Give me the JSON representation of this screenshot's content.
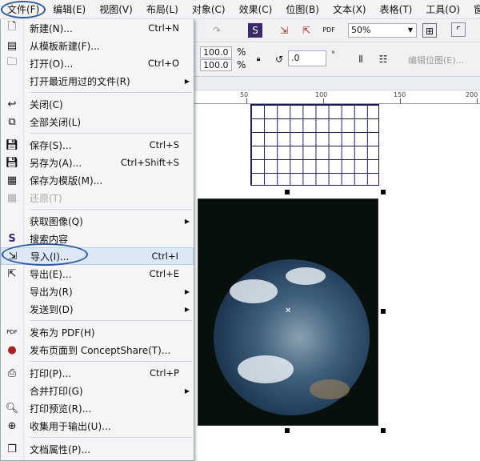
{
  "menubar": [
    "文件(F)",
    "编辑(E)",
    "视图(V)",
    "布局(L)",
    "对象(C)",
    "效果(C)",
    "位图(B)",
    "文本(X)",
    "表格(T)",
    "工具(O)",
    "窗口"
  ],
  "toolbar": {
    "zoom": "50%",
    "scale_x": "100.0",
    "scale_y": "100.0",
    "percent": "%",
    "angle": ".0",
    "degree": "°",
    "edit_bitmap": "编辑位图(E)..."
  },
  "ruler": [
    "50",
    "100",
    "150",
    "200"
  ],
  "file_menu": [
    {
      "icon": "new-icon",
      "label": "新建(N)...",
      "shortcut": "Ctrl+N"
    },
    {
      "icon": "template-icon",
      "label": "从模板新建(F)..."
    },
    {
      "icon": "open-folder-icon",
      "label": "打开(O)...",
      "shortcut": "Ctrl+O"
    },
    {
      "label": "打开最近用过的文件(R)",
      "submenu": true
    },
    {
      "sep": true
    },
    {
      "icon": "close-icon",
      "label": "关闭(C)"
    },
    {
      "icon": "close-all-icon",
      "label": "全部关闭(L)"
    },
    {
      "sep": true
    },
    {
      "icon": "save-icon",
      "label": "保存(S)...",
      "shortcut": "Ctrl+S"
    },
    {
      "icon": "save-as-icon",
      "label": "另存为(A)...",
      "shortcut": "Ctrl+Shift+S"
    },
    {
      "icon": "save-template-icon",
      "label": "保存为模版(M)..."
    },
    {
      "icon": "revert-icon",
      "label": "还原(T)",
      "disabled": true
    },
    {
      "sep": true
    },
    {
      "label": "获取图像(Q)",
      "submenu": true
    },
    {
      "icon": "search-content-icon",
      "label": "搜索内容"
    },
    {
      "icon": "import-icon",
      "label": "导入(I)...",
      "shortcut": "Ctrl+I",
      "highlighted": true
    },
    {
      "icon": "export-icon",
      "label": "导出(E)...",
      "shortcut": "Ctrl+E"
    },
    {
      "label": "导出为(R)",
      "submenu": true
    },
    {
      "label": "发送到(D)",
      "submenu": true
    },
    {
      "sep": true
    },
    {
      "icon": "pdf-icon",
      "label": "发布为 PDF(H)"
    },
    {
      "icon": "conceptshare-icon",
      "label": "发布页面到 ConceptShare(T)..."
    },
    {
      "sep": true
    },
    {
      "icon": "print-icon",
      "label": "打印(P)...",
      "shortcut": "Ctrl+P"
    },
    {
      "label": "合并打印(G)",
      "submenu": true
    },
    {
      "icon": "print-preview-icon",
      "label": "打印预览(R)..."
    },
    {
      "icon": "collect-output-icon",
      "label": "收集用于输出(U)..."
    },
    {
      "sep": true
    },
    {
      "icon": "document-properties-icon",
      "label": "文档属性(P)..."
    }
  ]
}
